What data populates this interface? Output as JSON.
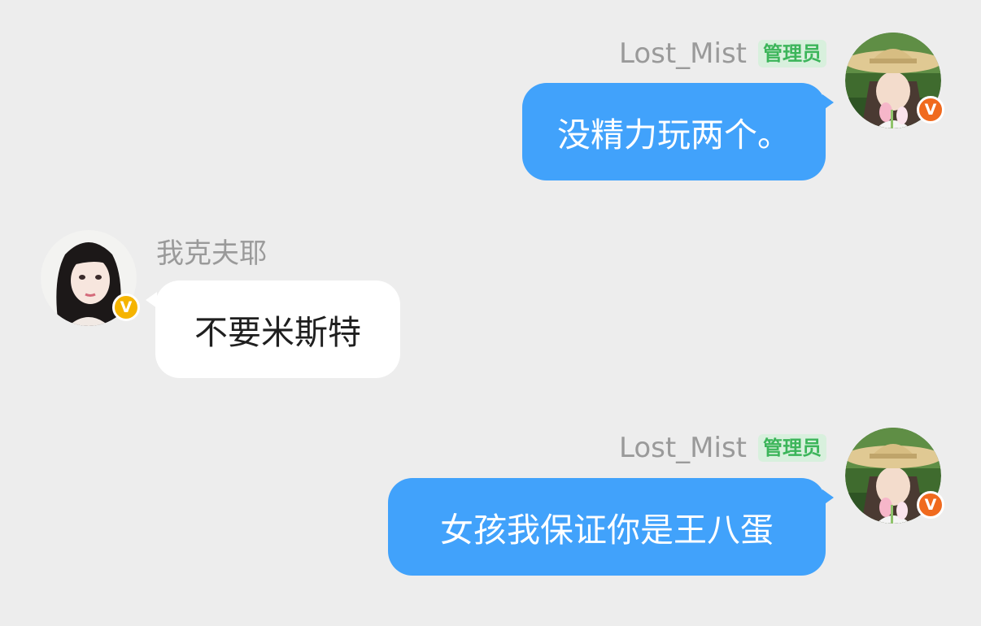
{
  "messages": [
    {
      "direction": "outgoing",
      "sender": "Lost_Mist",
      "role": "管理员",
      "text": "没精力玩两个。",
      "avatar_icon": "woman-straw-hat-avatar",
      "badge_letter": "V",
      "badge_color": "#f06a1e"
    },
    {
      "direction": "incoming",
      "sender": "我克夫耶",
      "role": "",
      "text": "不要米斯特",
      "avatar_icon": "woman-dark-hair-avatar",
      "badge_letter": "V",
      "badge_color": "#f5b400"
    },
    {
      "direction": "outgoing",
      "sender": "Lost_Mist",
      "role": "管理员",
      "text": "女孩我保证你是王八蛋",
      "avatar_icon": "woman-straw-hat-avatar",
      "badge_letter": "V",
      "badge_color": "#f06a1e"
    }
  ],
  "colors": {
    "background": "#ededed",
    "outgoing_bubble": "#41a2fb",
    "incoming_bubble": "#ffffff",
    "role_badge_bg": "#d8f0dd",
    "role_badge_text": "#3cb55a",
    "name_text": "#9a9a9a"
  }
}
